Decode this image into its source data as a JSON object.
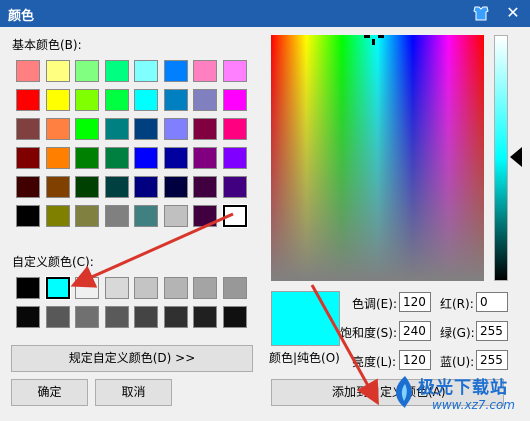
{
  "window": {
    "title": "颜色",
    "close_glyph": "✕"
  },
  "basic": {
    "label": "基本颜色(B):",
    "colors": [
      [
        "#ff8080",
        "#ffff80",
        "#80ff80",
        "#00ff80",
        "#80ffff",
        "#0080ff",
        "#ff80c0",
        "#ff80ff"
      ],
      [
        "#ff0000",
        "#ffff00",
        "#80ff00",
        "#00ff40",
        "#00ffff",
        "#0080c0",
        "#8080c0",
        "#ff00ff"
      ],
      [
        "#804040",
        "#ff8040",
        "#00ff00",
        "#008080",
        "#004080",
        "#8080ff",
        "#800040",
        "#ff0080"
      ],
      [
        "#800000",
        "#ff8000",
        "#008000",
        "#008040",
        "#0000ff",
        "#0000a0",
        "#800080",
        "#8000ff"
      ],
      [
        "#400000",
        "#804000",
        "#004000",
        "#004040",
        "#000080",
        "#000040",
        "#400040",
        "#400080"
      ],
      [
        "#000000",
        "#808000",
        "#808040",
        "#808080",
        "#408080",
        "#c0c0c0",
        "#400040",
        "#ffffff"
      ]
    ]
  },
  "custom": {
    "label": "自定义颜色(C):",
    "colors": [
      [
        "#000000",
        "#00ffff",
        "#f0f0f0",
        "#d8d8d8",
        "#c4c4c4",
        "#b4b4b4",
        "#a4a4a4",
        "#989898"
      ],
      [
        "#080808",
        "#585858",
        "#707070",
        "#5a5a5a",
        "#444444",
        "#303030",
        "#202020",
        "#101010"
      ]
    ]
  },
  "buttons": {
    "define_custom": "规定自定义颜色(D) >>",
    "ok": "确定",
    "cancel": "取消",
    "add_custom": "添加到自定义颜色(A)"
  },
  "preview": {
    "label": "颜色|纯色(O)",
    "color": "#00ffff"
  },
  "fields": {
    "hue": {
      "label": "色调(E):",
      "value": "120"
    },
    "sat": {
      "label": "饱和度(S):",
      "value": "240"
    },
    "lum": {
      "label": "亮度(L):",
      "value": "120"
    },
    "red": {
      "label": "红(R):",
      "value": "0"
    },
    "green": {
      "label": "绿(G):",
      "value": "255"
    },
    "blue": {
      "label": "蓝(U):",
      "value": "255"
    }
  },
  "watermark": {
    "title": "极光下载站",
    "url": "www.xz7.com"
  },
  "colors": {
    "titlebar": "#1f5fae",
    "arrow": "#d9362b",
    "selected": "#00ffff"
  }
}
